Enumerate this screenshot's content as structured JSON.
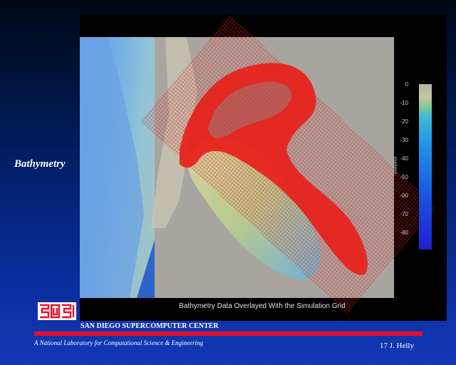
{
  "slide": {
    "label": "Bathymetry"
  },
  "figure": {
    "caption": "Bathymetry Data Overlayed With the Simulation Grid",
    "colorbar": {
      "unit_label": "meters",
      "tick_labels": [
        "0",
        "-10",
        "-20",
        "-30",
        "-40",
        "-50",
        "-60",
        "-70",
        "-80"
      ]
    },
    "colors": {
      "grid_overlay": "#e8201a",
      "land": "#a8a4a0",
      "shallow": "#d8d29a",
      "deep": "#3b7fd6"
    }
  },
  "footer": {
    "org_name": "SAN DIEGO SUPERCOMPUTER CENTER",
    "tagline": "A National Laboratory for Computational Science & Engineering",
    "credit": "17 J. Helly",
    "divider_color": "#e8102a"
  },
  "logo": {
    "icon": "sdsc-logo-icon",
    "color": "#e8102a"
  }
}
